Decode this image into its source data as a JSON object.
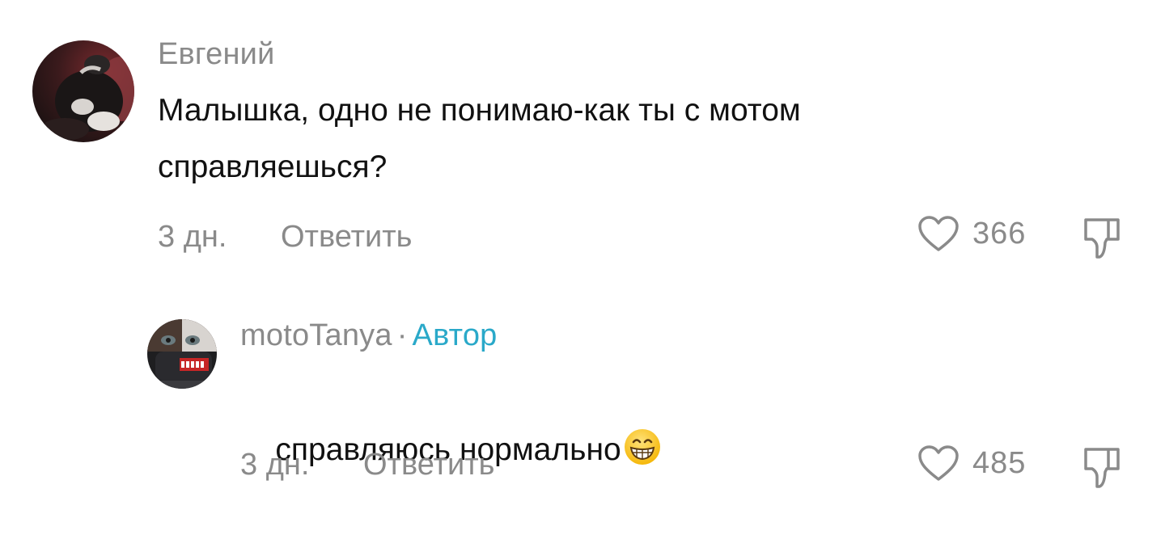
{
  "comments": [
    {
      "author": "Евгений",
      "text": "Малышка, одно не понимаю-как ты с мотом справляешься?",
      "time": "3 дн.",
      "reply_label": "Ответить",
      "likes": "366",
      "avatar_icon": "cat-photo-avatar"
    },
    {
      "author": "motoTanya",
      "separator": "·",
      "author_badge": "Автор",
      "text": "справляюсь нормально",
      "emoji_icon": "grinning-face-emoji",
      "time": "3 дн.",
      "reply_label": "Ответить",
      "likes": "485",
      "avatar_icon": "helmet-rider-avatar"
    }
  ],
  "colors": {
    "meta_gray": "#8a8a8a",
    "author_badge": "#2aa9c9",
    "text": "#111111"
  }
}
